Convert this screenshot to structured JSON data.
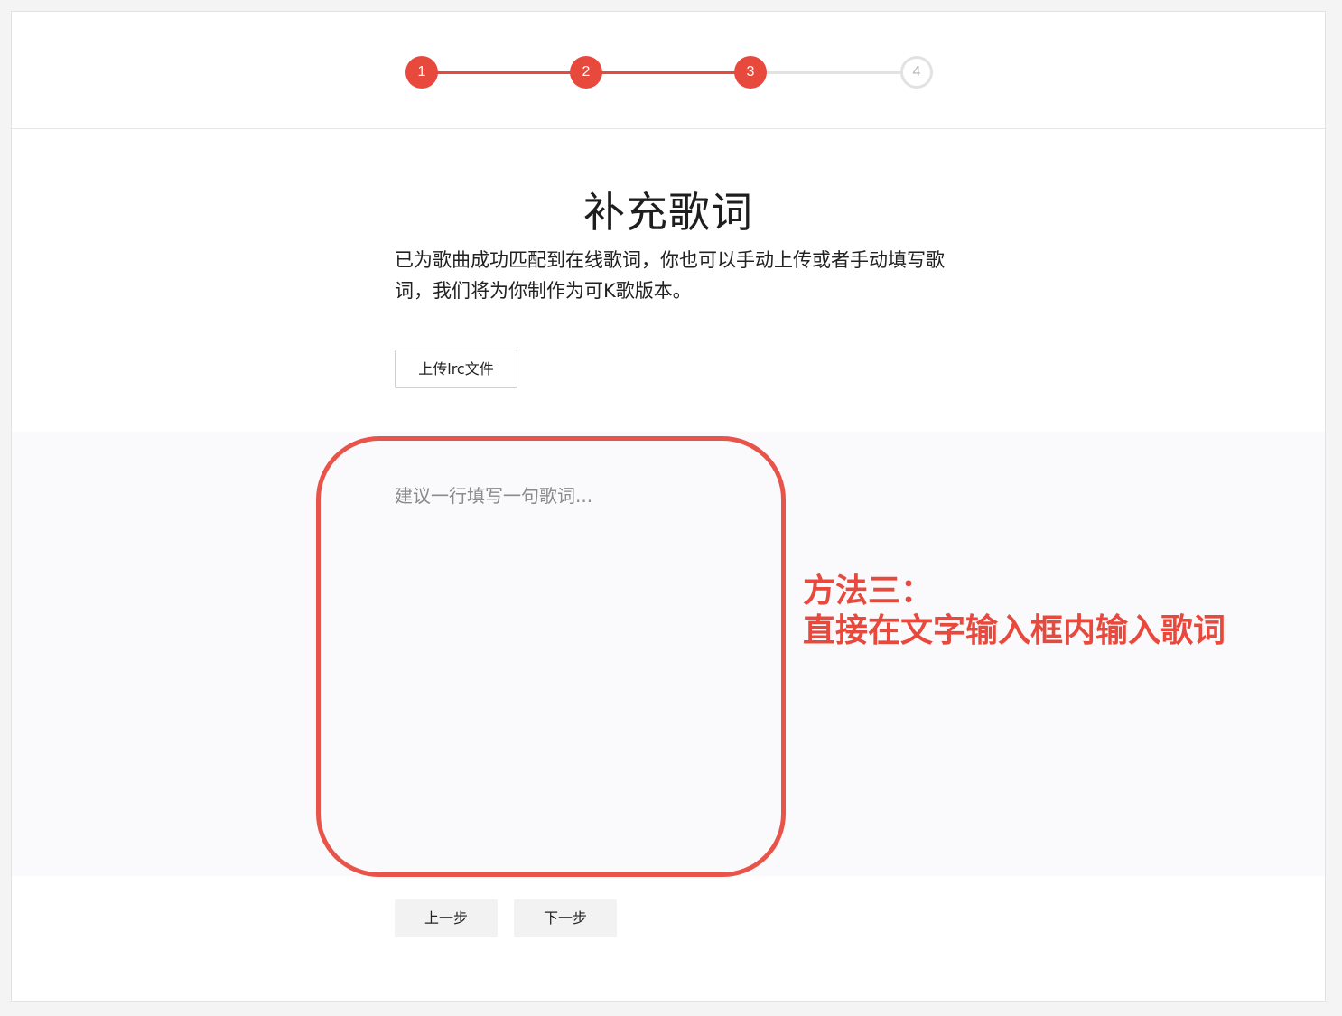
{
  "stepper": {
    "steps": [
      {
        "label": "1",
        "state": "done"
      },
      {
        "label": "2",
        "state": "done"
      },
      {
        "label": "3",
        "state": "done"
      },
      {
        "label": "4",
        "state": "todo"
      }
    ],
    "accent_color": "#e8493d",
    "inactive_color": "#e2e2e2"
  },
  "page": {
    "title": "补充歌词",
    "description": "已为歌曲成功匹配到在线歌词，你也可以手动上传或者手动填写歌词，我们将为你制作为可K歌版本。",
    "upload_button": "上传lrc文件"
  },
  "lyrics_input": {
    "placeholder": "建议一行填写一句歌词...",
    "value": ""
  },
  "annotation": {
    "line1": "方法三：",
    "line2": "直接在文字输入框内输入歌词",
    "color": "#e8493d"
  },
  "footer": {
    "prev_button": "上一步",
    "next_button": "下一步"
  }
}
